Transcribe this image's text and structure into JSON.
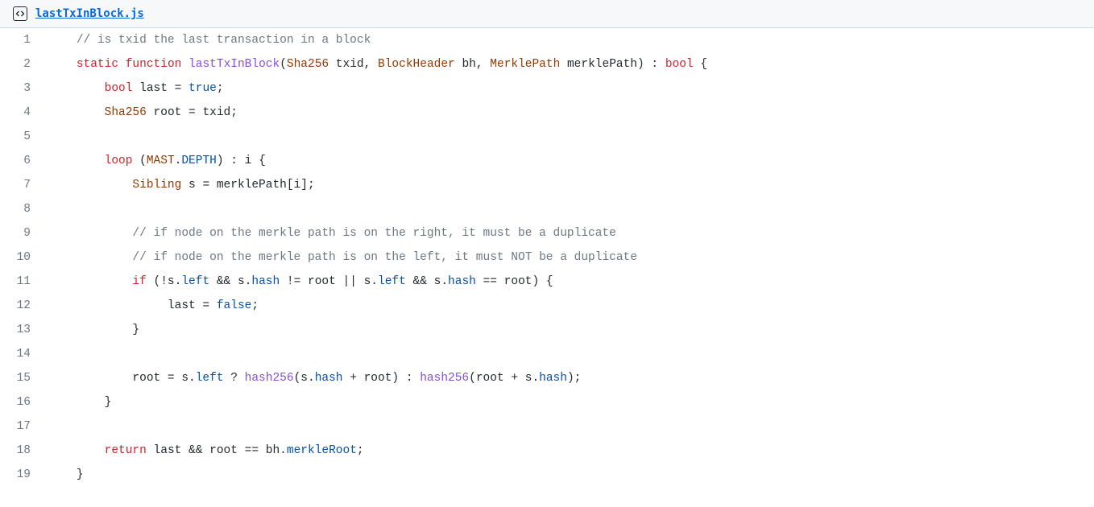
{
  "header": {
    "filename": "lastTxInBlock.js"
  },
  "code": {
    "lines": [
      {
        "n": 1,
        "tokens": [
          {
            "t": "    ",
            "c": ""
          },
          {
            "t": "// is txid the last transaction in a block",
            "c": "c-comment"
          }
        ]
      },
      {
        "n": 2,
        "tokens": [
          {
            "t": "    ",
            "c": ""
          },
          {
            "t": "static",
            "c": "c-kw"
          },
          {
            "t": " ",
            "c": ""
          },
          {
            "t": "function",
            "c": "c-kw"
          },
          {
            "t": " ",
            "c": ""
          },
          {
            "t": "lastTxInBlock",
            "c": "c-fn"
          },
          {
            "t": "(",
            "c": ""
          },
          {
            "t": "Sha256",
            "c": "c-type"
          },
          {
            "t": " txid, ",
            "c": ""
          },
          {
            "t": "BlockHeader",
            "c": "c-type"
          },
          {
            "t": " bh, ",
            "c": ""
          },
          {
            "t": "MerklePath",
            "c": "c-type"
          },
          {
            "t": " merklePath) : ",
            "c": ""
          },
          {
            "t": "bool",
            "c": "c-kw"
          },
          {
            "t": " {",
            "c": ""
          }
        ]
      },
      {
        "n": 3,
        "tokens": [
          {
            "t": "        ",
            "c": ""
          },
          {
            "t": "bool",
            "c": "c-kw"
          },
          {
            "t": " last = ",
            "c": ""
          },
          {
            "t": "true",
            "c": "c-num"
          },
          {
            "t": ";",
            "c": ""
          }
        ]
      },
      {
        "n": 4,
        "tokens": [
          {
            "t": "        ",
            "c": ""
          },
          {
            "t": "Sha256",
            "c": "c-type"
          },
          {
            "t": " root = txid;",
            "c": ""
          }
        ]
      },
      {
        "n": 5,
        "tokens": [
          {
            "t": "",
            "c": ""
          }
        ]
      },
      {
        "n": 6,
        "tokens": [
          {
            "t": "        ",
            "c": ""
          },
          {
            "t": "loop",
            "c": "c-kw"
          },
          {
            "t": " (",
            "c": ""
          },
          {
            "t": "MAST",
            "c": "c-type"
          },
          {
            "t": ".",
            "c": ""
          },
          {
            "t": "DEPTH",
            "c": "c-num"
          },
          {
            "t": ") : i {",
            "c": ""
          }
        ]
      },
      {
        "n": 7,
        "tokens": [
          {
            "t": "            ",
            "c": ""
          },
          {
            "t": "Sibling",
            "c": "c-type"
          },
          {
            "t": " s = merklePath[i];",
            "c": ""
          }
        ]
      },
      {
        "n": 8,
        "tokens": [
          {
            "t": "",
            "c": ""
          }
        ]
      },
      {
        "n": 9,
        "tokens": [
          {
            "t": "            ",
            "c": ""
          },
          {
            "t": "// if node on the merkle path is on the right, it must be a duplicate",
            "c": "c-comment"
          }
        ]
      },
      {
        "n": 10,
        "tokens": [
          {
            "t": "            ",
            "c": ""
          },
          {
            "t": "// if node on the merkle path is on the left, it must NOT be a duplicate",
            "c": "c-comment"
          }
        ]
      },
      {
        "n": 11,
        "tokens": [
          {
            "t": "            ",
            "c": ""
          },
          {
            "t": "if",
            "c": "c-kw"
          },
          {
            "t": " (!s.",
            "c": ""
          },
          {
            "t": "left",
            "c": "c-num"
          },
          {
            "t": " && s.",
            "c": ""
          },
          {
            "t": "hash",
            "c": "c-num"
          },
          {
            "t": " != root || s.",
            "c": ""
          },
          {
            "t": "left",
            "c": "c-num"
          },
          {
            "t": " && s.",
            "c": ""
          },
          {
            "t": "hash",
            "c": "c-num"
          },
          {
            "t": " == root) {",
            "c": ""
          }
        ]
      },
      {
        "n": 12,
        "tokens": [
          {
            "t": "                 last = ",
            "c": ""
          },
          {
            "t": "false",
            "c": "c-num"
          },
          {
            "t": ";",
            "c": ""
          }
        ]
      },
      {
        "n": 13,
        "tokens": [
          {
            "t": "            }",
            "c": ""
          }
        ]
      },
      {
        "n": 14,
        "tokens": [
          {
            "t": "",
            "c": ""
          }
        ]
      },
      {
        "n": 15,
        "tokens": [
          {
            "t": "            root = s.",
            "c": ""
          },
          {
            "t": "left",
            "c": "c-num"
          },
          {
            "t": " ? ",
            "c": ""
          },
          {
            "t": "hash256",
            "c": "c-fn"
          },
          {
            "t": "(s.",
            "c": ""
          },
          {
            "t": "hash",
            "c": "c-num"
          },
          {
            "t": " + root) : ",
            "c": ""
          },
          {
            "t": "hash256",
            "c": "c-fn"
          },
          {
            "t": "(root + s.",
            "c": ""
          },
          {
            "t": "hash",
            "c": "c-num"
          },
          {
            "t": ");",
            "c": ""
          }
        ]
      },
      {
        "n": 16,
        "tokens": [
          {
            "t": "        }",
            "c": ""
          }
        ]
      },
      {
        "n": 17,
        "tokens": [
          {
            "t": "",
            "c": ""
          }
        ]
      },
      {
        "n": 18,
        "tokens": [
          {
            "t": "        ",
            "c": ""
          },
          {
            "t": "return",
            "c": "c-kw"
          },
          {
            "t": " last && root == bh.",
            "c": ""
          },
          {
            "t": "merkleRoot",
            "c": "c-num"
          },
          {
            "t": ";",
            "c": ""
          }
        ]
      },
      {
        "n": 19,
        "tokens": [
          {
            "t": "    }",
            "c": ""
          }
        ]
      }
    ]
  }
}
